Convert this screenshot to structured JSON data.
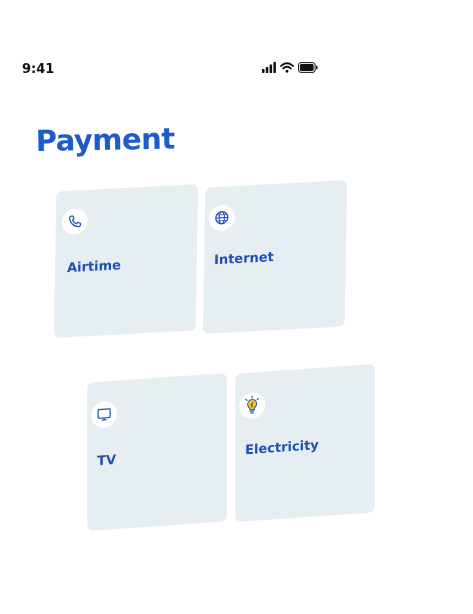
{
  "status_bar": {
    "time": "9:41",
    "icons": [
      "signal-icon",
      "wifi-icon",
      "battery-icon"
    ]
  },
  "page": {
    "title": "Payment"
  },
  "cards": [
    {
      "id": "airtime",
      "label": "Airtime",
      "icon": "phone-icon"
    },
    {
      "id": "internet",
      "label": "Internet",
      "icon": "globe-icon"
    },
    {
      "id": "tv",
      "label": "TV",
      "icon": "tv-icon"
    },
    {
      "id": "electricity",
      "label": "Electricity",
      "icon": "lightbulb-icon"
    }
  ],
  "colors": {
    "accent": "#1e5cc9",
    "card_background": "#e7eef2",
    "bulb": "#f5c518"
  }
}
